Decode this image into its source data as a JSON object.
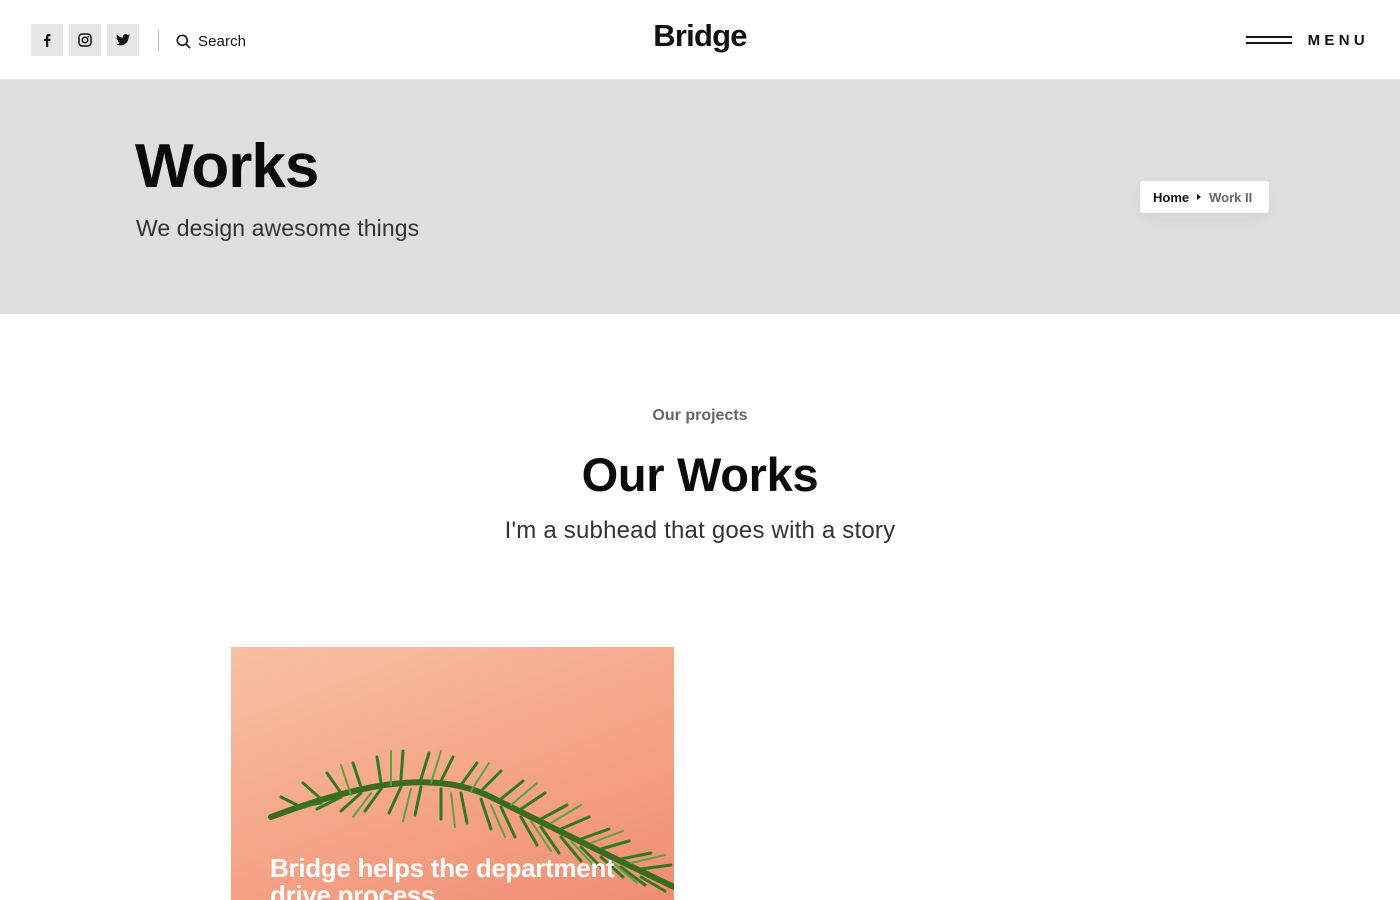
{
  "header": {
    "social": [
      {
        "icon": "facebook-icon"
      },
      {
        "icon": "instagram-icon"
      },
      {
        "icon": "twitter-icon"
      }
    ],
    "search_label": "Search",
    "logo": "Bridge",
    "menu_label": "MENU"
  },
  "title_band": {
    "title": "Works",
    "subtitle": "We design awesome things",
    "breadcrumb": {
      "home": "Home",
      "current": "Work II"
    }
  },
  "section": {
    "eyebrow": "Our projects",
    "title": "Our Works",
    "subhead": "I'm a subhead that goes with a story"
  },
  "projects": [
    {
      "title": "Bridge helps the department drive process"
    }
  ],
  "colors": {
    "band_bg": "#dfdfdf",
    "icon_bg": "#e6e6e6",
    "text_dark": "#111111",
    "card_tone": "#f6a98c",
    "plant_green": "#2f7a1f"
  }
}
